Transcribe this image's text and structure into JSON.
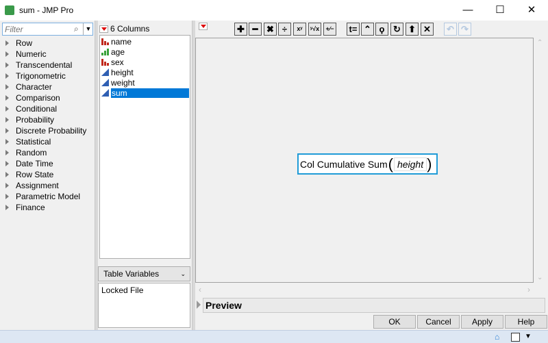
{
  "window": {
    "title": "sum - JMP Pro",
    "minimize": "—",
    "maximize": "☐",
    "close": "✕"
  },
  "functions": {
    "filter_placeholder": "Filter",
    "categories": [
      "Row",
      "Numeric",
      "Transcendental",
      "Trigonometric",
      "Character",
      "Comparison",
      "Conditional",
      "Probability",
      "Discrete Probability",
      "Statistical",
      "Random",
      "Date Time",
      "Row State",
      "Assignment",
      "Parametric Model",
      "Finance"
    ]
  },
  "columns": {
    "header": "6 Columns",
    "items": [
      {
        "name": "name",
        "type": "nominal"
      },
      {
        "name": "age",
        "type": "ordinal"
      },
      {
        "name": "sex",
        "type": "nominal"
      },
      {
        "name": "height",
        "type": "continuous"
      },
      {
        "name": "weight",
        "type": "continuous"
      },
      {
        "name": "sum",
        "type": "continuous",
        "selected": true
      }
    ],
    "table_vars_select": "Table Variables",
    "table_vars_content": "Locked File"
  },
  "toolbar": [
    "plus-icon",
    "minus-icon",
    "multiply-icon",
    "divide-icon",
    "power-icon",
    "root-icon",
    "negate-icon",
    "assign-icon",
    "caret-icon",
    "local-icon",
    "loop-icon",
    "peel-icon",
    "delete-icon",
    "undo-icon",
    "redo-icon"
  ],
  "toolbar_glyphs": [
    "✚",
    "━",
    "✖",
    "÷",
    "xʸ",
    "ʸ√x",
    "+∕−",
    "t=",
    "⌃",
    "ϙ",
    "↻",
    "⬆",
    "✕",
    "↶",
    "↷"
  ],
  "formula": {
    "function": "Col Cumulative Sum",
    "argument": "height"
  },
  "preview_label": "Preview",
  "buttons": {
    "ok": "OK",
    "cancel": "Cancel",
    "apply": "Apply",
    "help": "Help"
  },
  "colors": {
    "accent": "#0078d7",
    "formula_border": "#1f9bd7",
    "nominal": "#c0281c",
    "ordinal": "#3aa13a",
    "continuous": "#2f5fb3"
  }
}
